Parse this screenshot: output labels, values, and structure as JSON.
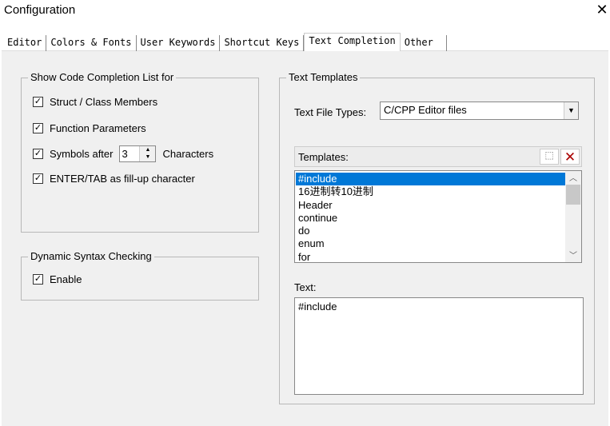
{
  "window": {
    "title": "Configuration",
    "close_icon": "close-icon"
  },
  "tabs": [
    {
      "label": "Editor"
    },
    {
      "label": "Colors & Fonts"
    },
    {
      "label": "User Keywords"
    },
    {
      "label": "Shortcut Keys"
    },
    {
      "label": "Text Completion",
      "active": true
    },
    {
      "label": "Other"
    }
  ],
  "completion": {
    "legend": "Show Code Completion List for",
    "struct": "Struct / Class Members",
    "func": "Function Parameters",
    "symbols_before": "Symbols after",
    "symbols_value": "3",
    "symbols_after": "Characters",
    "enter": "ENTER/TAB as fill-up character",
    "check": "✓"
  },
  "syntax": {
    "legend": "Dynamic Syntax Checking",
    "enable": "Enable"
  },
  "templates": {
    "legend": "Text Templates",
    "file_types_label": "Text File Types:",
    "file_types_value": "C/CPP Editor files",
    "list_label": "Templates:",
    "items": [
      "#include",
      "16进制转10进制",
      "Header",
      "continue",
      "do",
      "enum",
      "for"
    ],
    "selected": "#include",
    "text_label": "Text:",
    "text_value": "#include",
    "selection_color": "#0078d7"
  }
}
